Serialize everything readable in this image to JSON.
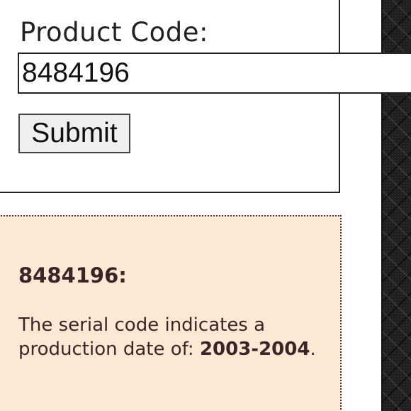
{
  "form": {
    "label": "Product Code:",
    "input_value": "8484196",
    "submit_label": "Submit"
  },
  "result": {
    "title": "8484196:",
    "text_prefix": "The serial code indicates a production date of: ",
    "date_range": "2003-2004",
    "text_suffix": "."
  },
  "colors": {
    "result_background": "#fde9d3",
    "result_text": "#3b2528",
    "button_background": "#efefef"
  }
}
